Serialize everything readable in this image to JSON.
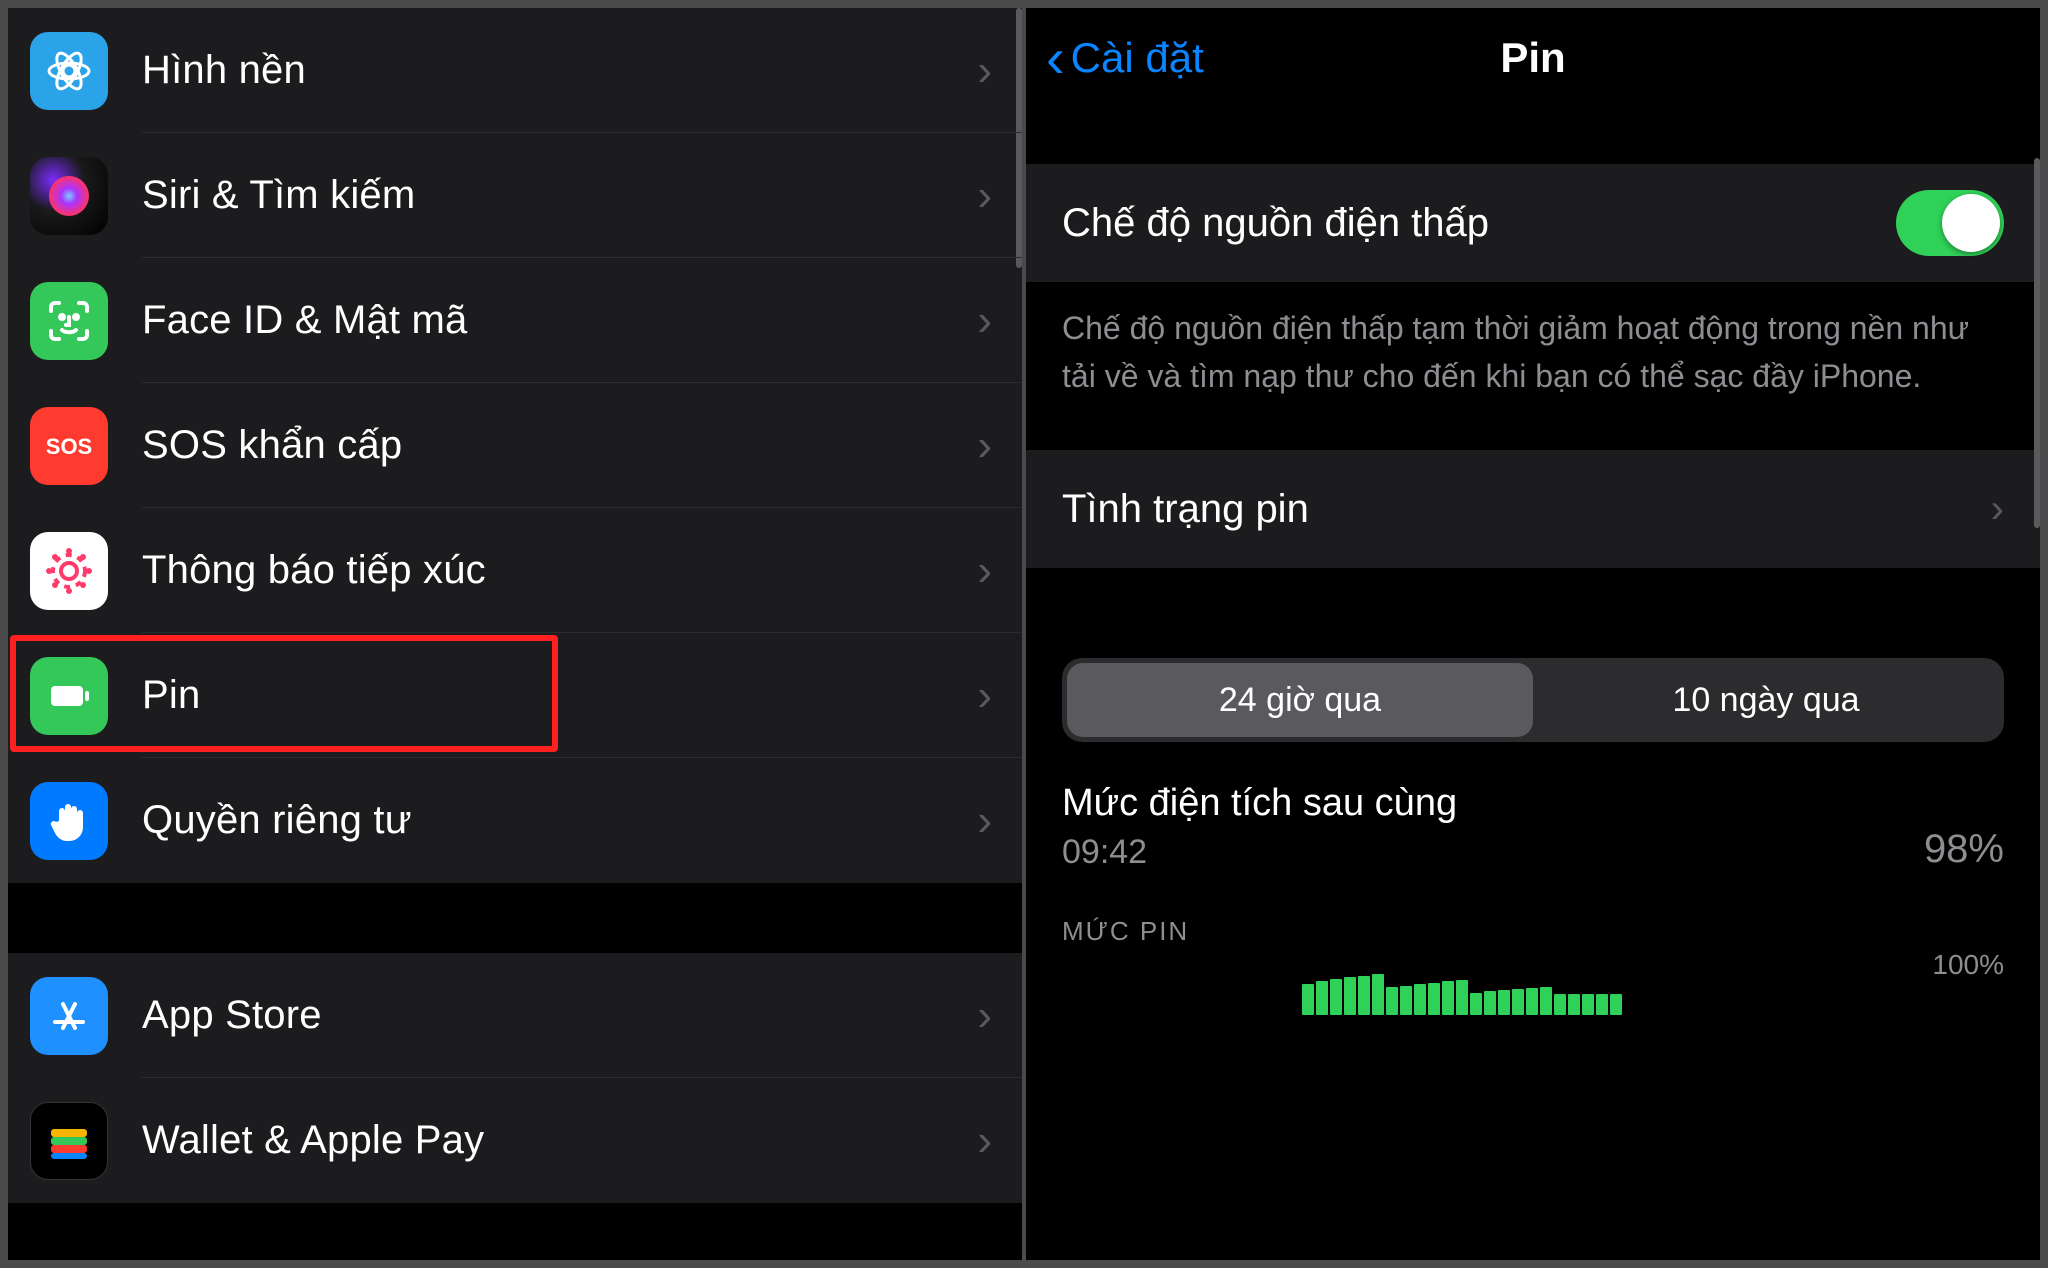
{
  "left": {
    "items": [
      {
        "key": "wallpaper",
        "label": "Hình nền",
        "icon": "flower-icon",
        "bg": "bg-blue1"
      },
      {
        "key": "siri",
        "label": "Siri & Tìm kiếm",
        "icon": "siri-icon",
        "bg": "bg-siri"
      },
      {
        "key": "faceid",
        "label": "Face ID & Mật mã",
        "icon": "faceid-icon",
        "bg": "bg-green1"
      },
      {
        "key": "sos",
        "label": "SOS khẩn cấp",
        "icon": "sos-icon",
        "bg": "bg-red1"
      },
      {
        "key": "exposure",
        "label": "Thông báo tiếp xúc",
        "icon": "exposure-icon",
        "bg": "bg-white"
      },
      {
        "key": "battery",
        "label": "Pin",
        "icon": "battery-icon",
        "bg": "bg-green2",
        "highlighted": true
      },
      {
        "key": "privacy",
        "label": "Quyền riêng tư",
        "icon": "hand-icon",
        "bg": "bg-blue2"
      }
    ],
    "items2": [
      {
        "key": "appstore",
        "label": "App Store",
        "icon": "appstore-icon",
        "bg": "bg-blue3"
      },
      {
        "key": "wallet",
        "label": "Wallet & Apple Pay",
        "icon": "wallet-icon",
        "bg": "bg-black"
      }
    ]
  },
  "right": {
    "nav_back": "Cài đặt",
    "nav_title": "Pin",
    "low_power_label": "Chế độ nguồn điện thấp",
    "low_power_on": true,
    "low_power_desc": "Chế độ nguồn điện thấp tạm thời giảm hoạt động trong nền như tải về và tìm nạp thư cho đến khi bạn có thể sạc đầy iPhone.",
    "battery_health_label": "Tình trạng pin",
    "segments": [
      "24 giờ qua",
      "10 ngày qua"
    ],
    "segment_selected": 0,
    "last_charge_title": "Mức điện tích sau cùng",
    "last_charge_time": "09:42",
    "last_charge_pct": "98%",
    "chart_section_label": "MỨC PIN",
    "chart_ymax_label": "100%"
  },
  "chart_data": {
    "type": "bar",
    "title": "MỨC PIN",
    "ylabel": "%",
    "ylim": [
      0,
      100
    ],
    "x_unit": "hour",
    "note": "Partial view of 24-hour battery level chart; visible bars only",
    "values": [
      55,
      60,
      65,
      68,
      70,
      74,
      50,
      52,
      55,
      58,
      60,
      62,
      40,
      42,
      44,
      46,
      48,
      50,
      38,
      38,
      38,
      38,
      38
    ]
  }
}
